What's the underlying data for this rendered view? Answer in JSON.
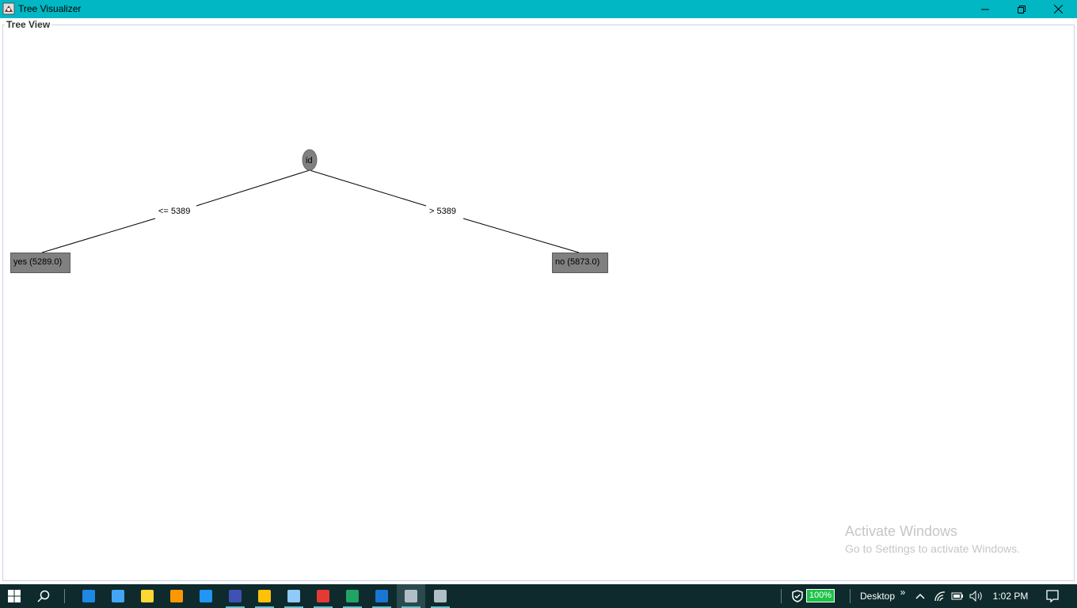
{
  "window": {
    "title": "Tree Visualizer",
    "app_icon": "weka-bird-icon",
    "controls": {
      "minimize": "minimize-icon",
      "restore": "restore-icon",
      "close": "close-icon"
    }
  },
  "panel": {
    "title": "Tree View"
  },
  "tree": {
    "root": {
      "label": "id"
    },
    "edges": [
      {
        "label": "<= 5389"
      },
      {
        "label": "> 5389"
      }
    ],
    "leaves": [
      {
        "label": "yes (5289.0)"
      },
      {
        "label": "no (5873.0)"
      }
    ]
  },
  "watermark": {
    "title": "Activate Windows",
    "subtitle": "Go to Settings to activate Windows."
  },
  "taskbar": {
    "apps": [
      {
        "name": "explorer-icon",
        "color": "#1e88e5"
      },
      {
        "name": "desktop-icon",
        "color": "#42a5f5"
      },
      {
        "name": "notepad-icon",
        "color": "#fdd835"
      },
      {
        "name": "sublime-icon",
        "color": "#ff9800"
      },
      {
        "name": "browser-compass-icon",
        "color": "#2196f3"
      },
      {
        "name": "eclipse-icon",
        "color": "#3f51b5"
      },
      {
        "name": "folder-icon",
        "color": "#ffc107"
      },
      {
        "name": "notes-icon",
        "color": "#90caf9"
      },
      {
        "name": "chrome-icon",
        "color": "#e53935"
      },
      {
        "name": "excel-icon",
        "color": "#21a366"
      },
      {
        "name": "photos-icon",
        "color": "#1976d2"
      },
      {
        "name": "weka-icon",
        "color": "#b0bec5"
      },
      {
        "name": "weka-icon",
        "color": "#b0bec5"
      }
    ],
    "battery": "100%",
    "desktop_label": "Desktop",
    "chevron": "»",
    "time": "1:02 PM",
    "colors": {
      "taskbar": "#0e2a2c",
      "titlebar": "#00b7c3",
      "node": "#808080"
    }
  }
}
